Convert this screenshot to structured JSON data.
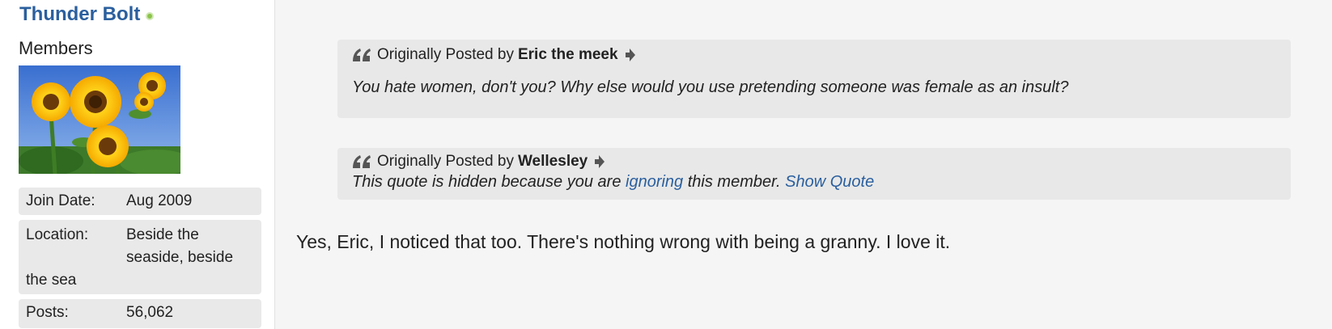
{
  "sidebar": {
    "username": "Thunder Bolt",
    "online_status": "online",
    "user_title": "Members",
    "avatar": "sunflowers",
    "join_date_label": "Join Date:",
    "join_date_value": "Aug 2009",
    "location_label": "Location:",
    "location_value_line1": "Beside the",
    "location_value_line2": "seaside, beside",
    "location_value_line3": "the sea",
    "posts_label": "Posts:",
    "posts_value": "56,062"
  },
  "quotes": [
    {
      "prefix": "Originally Posted by",
      "poster": "Eric the meek",
      "text": "You hate women, don't you? Why else would you use pretending someone was female as an insult?"
    },
    {
      "prefix": "Originally Posted by",
      "poster": "Wellesley",
      "hidden_text_1": "This quote is hidden because you are",
      "hidden_link": "ignoring",
      "hidden_text_2": "this member.",
      "show_link": "Show Quote"
    }
  ],
  "post": {
    "text": "Yes, Eric, I noticed that too. There's nothing wrong with being a granny. I love it."
  },
  "colors": {
    "link": "#2a5f9e",
    "quote_bg": "#e8e8e8",
    "info_bg": "#e9e9e9",
    "online": "#8bc34a"
  }
}
